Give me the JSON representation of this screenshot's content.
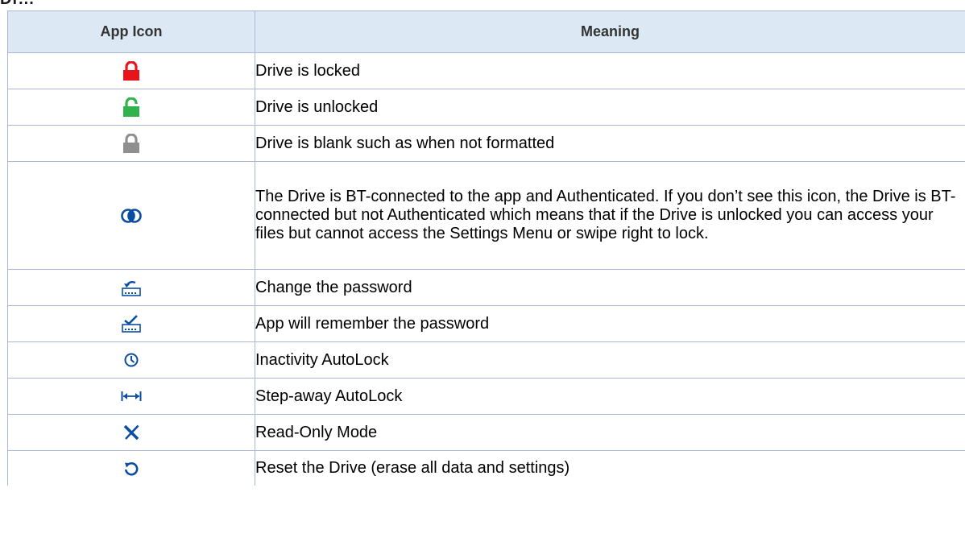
{
  "header_fragment": "Dr...",
  "table": {
    "columns": [
      "App Icon",
      "Meaning"
    ],
    "rows": [
      {
        "icon": "lock-icon",
        "color": "#e8141b",
        "meaning": "Drive is locked"
      },
      {
        "icon": "unlock-icon",
        "color": "#2fb34a",
        "meaning": "Drive is unlocked"
      },
      {
        "icon": "lock-icon",
        "color": "#8f8f8f",
        "meaning": "Drive is blank such as when not formatted"
      },
      {
        "icon": "authenticated-icon",
        "color": "#0a4ea3",
        "meaning": "The Drive is BT-connected to the app and Authenticated. If you don’t see this icon, the Drive is BT-connected but not Authenticated which means that if the Drive is unlocked you can access your files but cannot access the Settings Menu or swipe right to lock."
      },
      {
        "icon": "change-password-icon",
        "color": "#0a4ea3",
        "meaning": "Change the password"
      },
      {
        "icon": "remember-password-icon",
        "color": "#0a4ea3",
        "meaning": "App will remember the password"
      },
      {
        "icon": "clock-icon",
        "color": "#0a4ea3",
        "meaning": "Inactivity AutoLock"
      },
      {
        "icon": "step-away-icon",
        "color": "#0a4ea3",
        "meaning": "Step-away AutoLock"
      },
      {
        "icon": "read-only-icon",
        "color": "#0a4ea3",
        "meaning": "Read-Only Mode"
      },
      {
        "icon": "reset-icon",
        "color": "#0a4ea3",
        "meaning": "Reset the Drive (erase all data and settings)"
      }
    ]
  }
}
